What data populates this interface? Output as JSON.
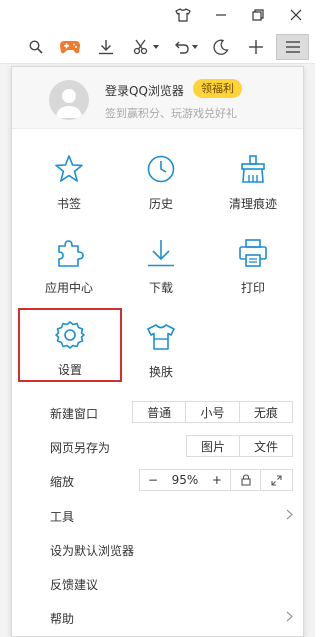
{
  "user": {
    "login_label": "登录QQ浏览器",
    "badge_label": "领福利",
    "subtitle": "签到赢积分、玩游戏兑好礼"
  },
  "grid": [
    {
      "label": "书签",
      "icon": "star-icon"
    },
    {
      "label": "历史",
      "icon": "clock-icon"
    },
    {
      "label": "清理痕迹",
      "icon": "broom-icon"
    },
    {
      "label": "应用中心",
      "icon": "puzzle-icon"
    },
    {
      "label": "下载",
      "icon": "download-icon"
    },
    {
      "label": "打印",
      "icon": "printer-icon"
    },
    {
      "label": "设置",
      "icon": "gear-icon"
    },
    {
      "label": "换肤",
      "icon": "tshirt-icon"
    }
  ],
  "rows": {
    "new_window": {
      "label": "新建窗口",
      "options": [
        "普通",
        "小号",
        "无痕"
      ]
    },
    "save_as": {
      "label": "网页另存为",
      "options": [
        "图片",
        "文件"
      ]
    },
    "zoom": {
      "label": "缩放",
      "minus": "−",
      "value": "95%",
      "plus": "+"
    },
    "tools": {
      "label": "工具"
    },
    "default_browser": {
      "label": "设为默认浏览器"
    },
    "feedback": {
      "label": "反馈建议"
    },
    "help": {
      "label": "帮助"
    }
  },
  "colors": {
    "accent": "#1b8fd6",
    "badge": "#ffd43b",
    "selection": "#d32f2f"
  }
}
